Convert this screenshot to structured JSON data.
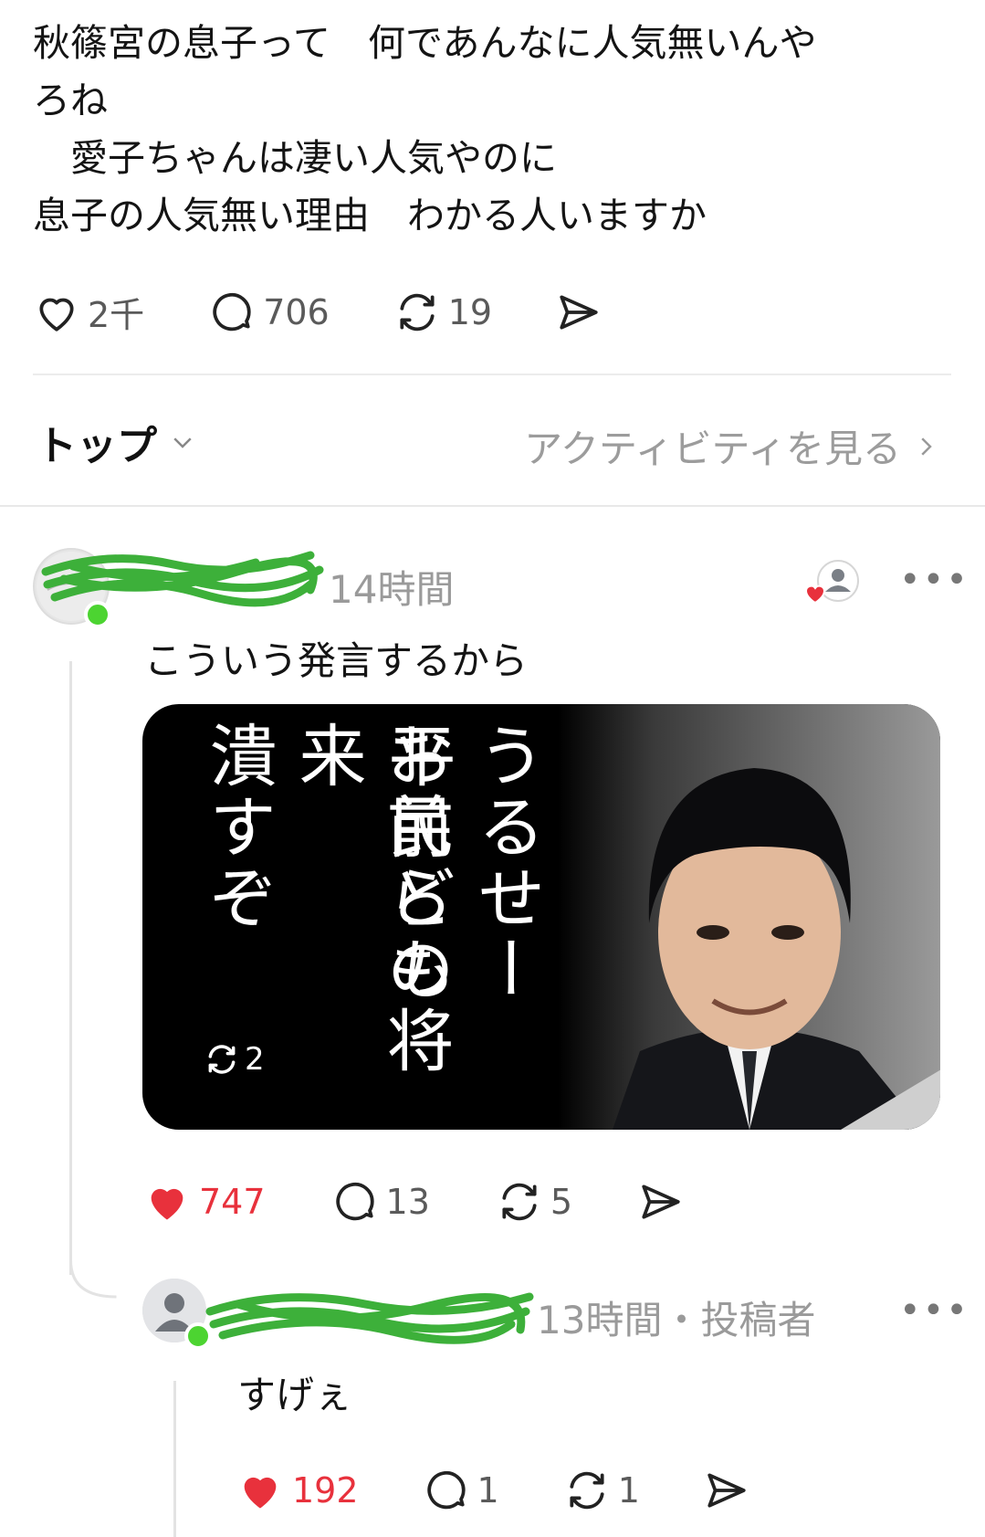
{
  "post": {
    "lines": [
      "秋篠宮の息子って　何であんなに人気無いんや",
      "ろね",
      "　愛子ちゃんは凄い人気やのに",
      "息子の人気無い理由　わかる人いますか"
    ],
    "likes": "2千",
    "replies": "706",
    "reposts": "19"
  },
  "sort": {
    "label": "トップ",
    "activity": "アクティビティを見る"
  },
  "comment1": {
    "time": "14時間",
    "text": "こういう発言するから",
    "media": {
      "caption_col1": "うるせー",
      "caption_col2": "平民ども",
      "caption_col3": "お前らの将来",
      "caption_col4": "潰すぞ",
      "reposts": "2"
    },
    "likes": "747",
    "replies": "13",
    "reposts": "5"
  },
  "comment2": {
    "time": "13時間・投稿者",
    "text": "すげぇ",
    "likes": "192",
    "replies": "1",
    "reposts": "1"
  },
  "colors": {
    "like_red": "#e8313c",
    "online_green": "#4cd431",
    "scribble_green": "#3db03a"
  }
}
